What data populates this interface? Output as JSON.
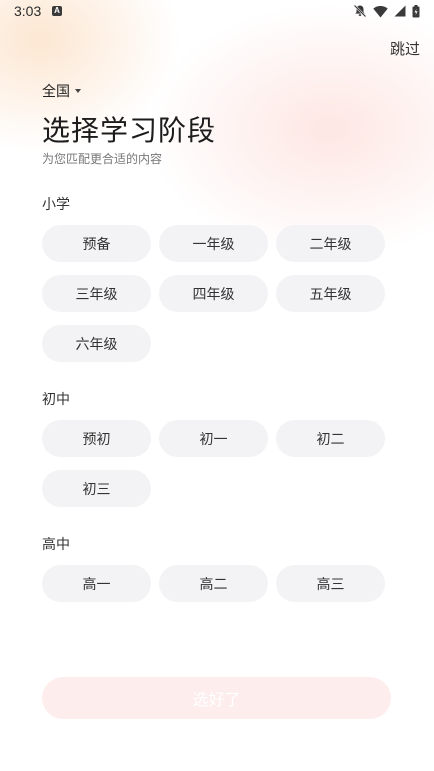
{
  "status_bar": {
    "time": "3:03",
    "a_icon": "A"
  },
  "header": {
    "skip_label": "跳过",
    "region_label": "全国",
    "title": "选择学习阶段",
    "subtitle": "为您匹配更合适的内容"
  },
  "sections": [
    {
      "label": "小学",
      "items": [
        "预备",
        "一年级",
        "二年级",
        "三年级",
        "四年级",
        "五年级",
        "六年级"
      ]
    },
    {
      "label": "初中",
      "items": [
        "预初",
        "初一",
        "初二",
        "初三"
      ]
    },
    {
      "label": "高中",
      "items": [
        "高一",
        "高二",
        "高三"
      ]
    }
  ],
  "footer": {
    "confirm_label": "选好了"
  },
  "colors": {
    "chip_bg": "#f3f3f5",
    "confirm_disabled_bg": "#fdeeed",
    "text_primary": "#222222"
  }
}
